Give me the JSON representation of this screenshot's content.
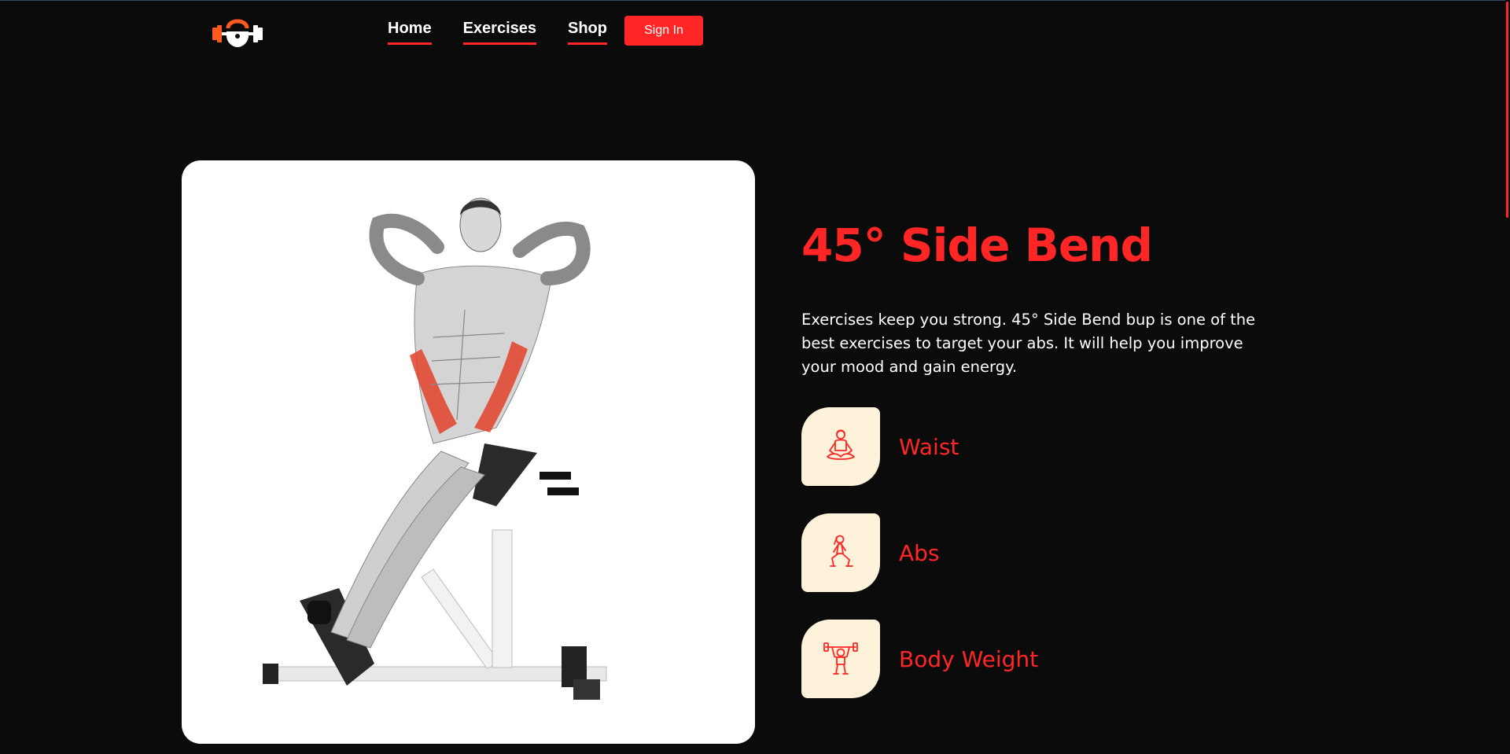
{
  "nav": {
    "links": [
      "Home",
      "Exercises",
      "Shop"
    ],
    "signin_label": "Sign In"
  },
  "colors": {
    "accent": "#ff2625",
    "background": "#0b0b0c",
    "icon_bg": "#fff2db"
  },
  "exercise": {
    "name": "45° Side Bend",
    "description": "Exercises keep you strong. 45° Side Bend bup is one of the best exercises to target your abs. It will help you improve your mood and gain energy.",
    "features": [
      {
        "label": "Waist",
        "icon": "meditation-icon"
      },
      {
        "label": "Abs",
        "icon": "lunge-icon"
      },
      {
        "label": "Body Weight",
        "icon": "weightlifter-icon"
      }
    ]
  }
}
